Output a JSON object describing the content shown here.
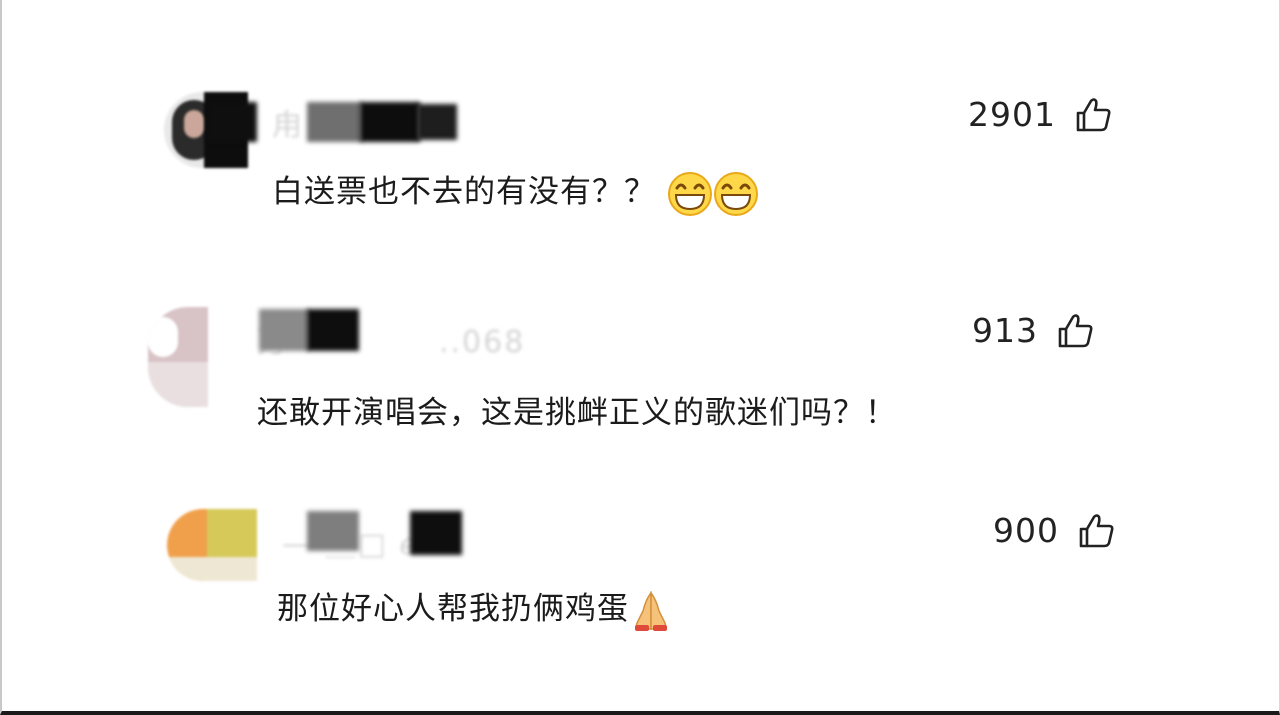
{
  "comments": [
    {
      "text": "白送票也不去的有没有？？",
      "likes": "2901",
      "emoji": "grinning-face-icon"
    },
    {
      "text": "还敢开演唱会，这是挑衅正义的歌迷们吗？！",
      "likes": "913",
      "emoji": ""
    },
    {
      "text": "那位好心人帮我扔俩鸡蛋",
      "likes": "900",
      "emoji": "praying-hands-icon"
    }
  ],
  "colors": {
    "text": "#1b1b1b",
    "like_count": "#222222",
    "background": "#ffffff",
    "mosaic_dark": "#111111",
    "mosaic_grey": "#7a7a7a"
  }
}
